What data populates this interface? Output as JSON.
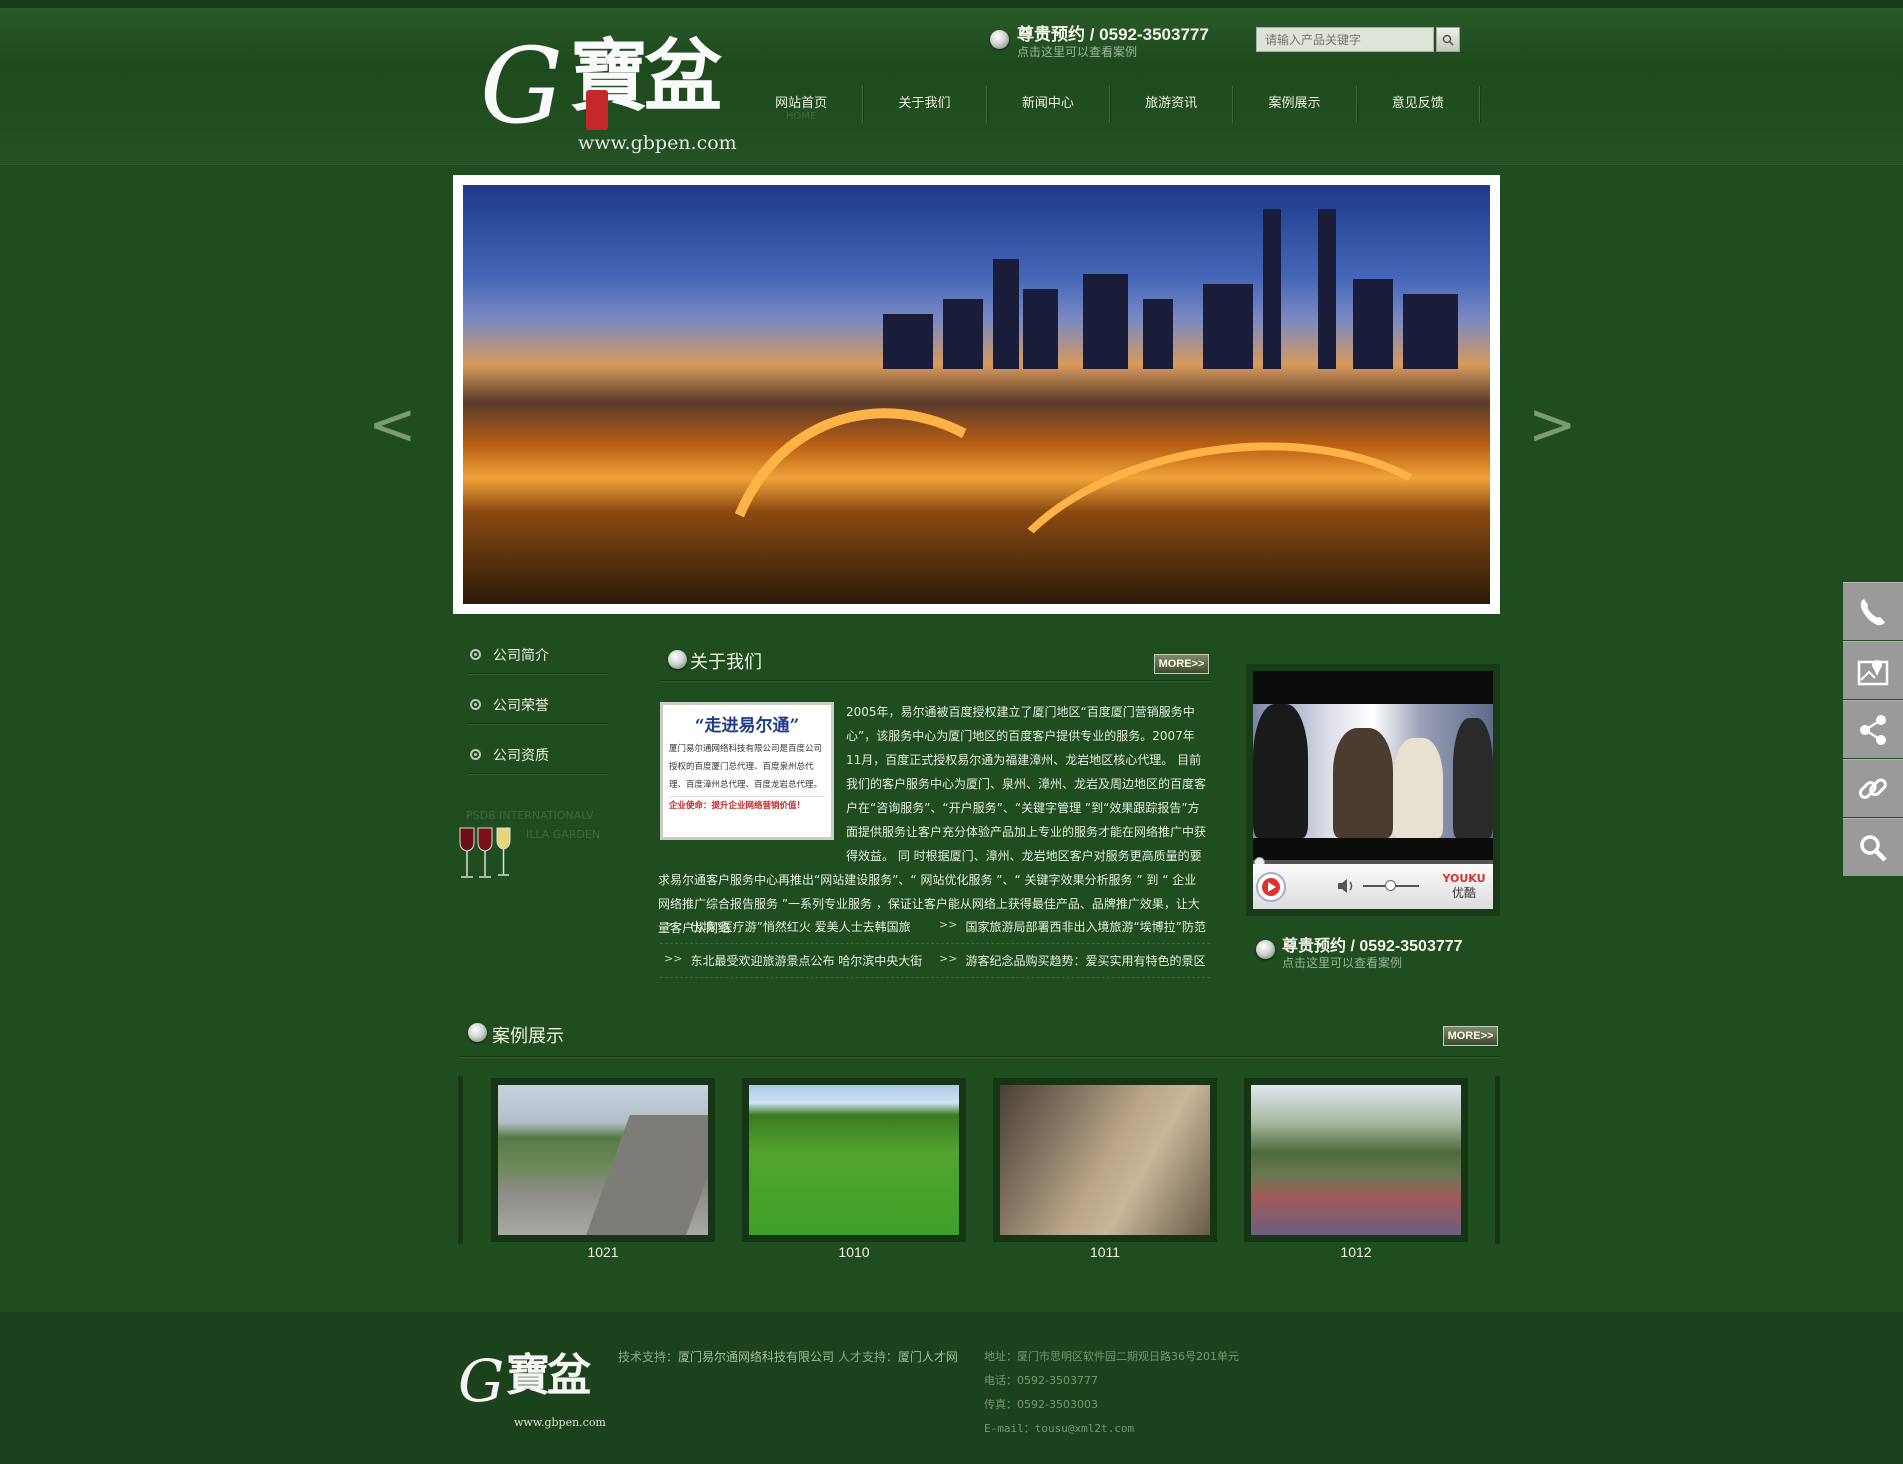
{
  "brand": {
    "logo_char": "G",
    "logo_text": "寶盆",
    "logo_url": "www.gbpen.com"
  },
  "header": {
    "booking_title": "尊贵预约 / 0592-3503777",
    "booking_sub": "点击这里可以查看案例",
    "search_placeholder": "请输入产品关键字",
    "search_icon": "search-icon"
  },
  "nav": [
    {
      "label": "网站首页",
      "en": "HOME"
    },
    {
      "label": "关于我们"
    },
    {
      "label": "新闻中心"
    },
    {
      "label": "旅游资讯"
    },
    {
      "label": "案例展示"
    },
    {
      "label": "意见反馈"
    }
  ],
  "banner": {
    "prev": "<",
    "next": ">"
  },
  "left_menu": [
    {
      "label": "公司简介"
    },
    {
      "label": "公司荣誉"
    },
    {
      "label": "公司资质"
    }
  ],
  "left_promo": {
    "line1": "PSDB INTERNATIONALV",
    "line2": "ILLA GARDEN"
  },
  "about": {
    "title": "关于我们",
    "more": "MORE>>",
    "card_title": "“走进易尔通”",
    "card_body": "厦门易尔通网络科技有限公司是百度公司授权的百度厦门总代理、百度泉州总代理、百度漳州总代理、百度龙岩总代理。",
    "card_mission": "企业使命：提升企业网络营销价值！",
    "text": "2005年，易尔通被百度授权建立了厦门地区“百度厦门营销服务中心”，该服务中心为厦门地区的百度客户提供专业的服务。2007年11月，百度正式授权易尔通为福建漳州、龙岩地区核心代理。 目前我们的客户服务中心为厦门、泉州、漳州、龙岩及周边地区的百度客户在“咨询服务”、“开户服务”、“关键字管理 ”到“效果跟踪报告”方面提供服务让客户充分体验产品加上专业的服务才能在网络推广中获得效益。 同 时根据厦门、漳州、龙岩地区客户对服务更高质量的要求易尔通客户服务中心再推出“网站建设服务”、“ 网站优化服务 ”、“ 关键字效果分析服务 ” 到 “ 企业网络推广综合报告服务 ”一系列专业服务 ，保证让客户能从网络上获得最佳产品、品牌推广效果，让大量客户从网络"
  },
  "news": [
    [
      "出境“医疗游”悄然红火 爱美人士去韩国旅",
      "国家旅游局部署西非出入境旅游“埃博拉”防范"
    ],
    [
      "东北最受欢迎旅游景点公布 哈尔滨中央大街",
      "游客纪念品购买趋势：爱买实用有特色的景区"
    ]
  ],
  "video": {
    "youku_en": "YOUKU",
    "youku_zh": "优酷"
  },
  "booking2": {
    "title": "尊贵预约 / 0592-3503777",
    "sub": "点击这里可以查看案例"
  },
  "cases": {
    "title": "案例展示",
    "more": "MORE>>",
    "items": [
      {
        "label": "1021"
      },
      {
        "label": "1010"
      },
      {
        "label": "1011"
      },
      {
        "label": "1012"
      }
    ]
  },
  "footer": {
    "tech_label": "技术支持：",
    "tech_value": "厦门易尔通网络科技有限公司",
    "talent_label": "人才支持：",
    "talent_value": "厦门人才网",
    "address": "地址：厦门市思明区软件园二期观日路36号201单元",
    "phone": "电话：0592-3503777",
    "fax": "传真：0592-3503003",
    "email": "E-mail：tousu@xml2t.com"
  },
  "side_buttons": [
    "phone-icon",
    "map-icon",
    "share-icon",
    "link-icon",
    "search-icon"
  ]
}
